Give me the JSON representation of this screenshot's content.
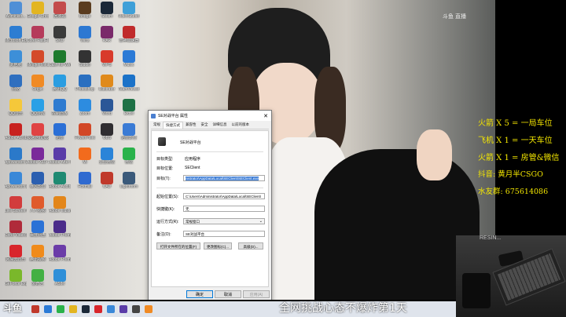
{
  "desktop": {
    "icons": [
      {
        "label": "Administr...",
        "color": "#4f8fd6"
      },
      {
        "label": "Google Chrome",
        "color": "#e3b521"
      },
      {
        "label": "回收站",
        "color": "#c34b4b"
      },
      {
        "label": "Microsoft Edge",
        "color": "#2d7dd2"
      },
      {
        "label": "Corel FastFlic...",
        "color": "#b53b5b"
      },
      {
        "label": "SKD",
        "color": "#3b3b3b"
      },
      {
        "label": "此电脑",
        "color": "#3d8fd8"
      },
      {
        "label": "Mindjet MindMan...",
        "color": "#d44a2a"
      },
      {
        "label": "Cash for Windows",
        "color": "#1e7a2d"
      },
      {
        "label": "网络",
        "color": "#2f6fbf"
      },
      {
        "label": "Origin",
        "color": "#f08a24"
      },
      {
        "label": "腾讯QQ",
        "color": "#2a9de1"
      },
      {
        "label": "QQ音乐",
        "color": "#f5c83a"
      },
      {
        "label": "QQ游戏",
        "color": "#2aa0e6"
      },
      {
        "label": "控制面板",
        "color": "#2f7bd0"
      },
      {
        "label": "Adobe Acrobat DC",
        "color": "#c8221f"
      },
      {
        "label": "极速游戏加速器",
        "color": "#e04343"
      },
      {
        "label": "迅雷",
        "color": "#2b6fd6"
      },
      {
        "label": "Apowersoft 录屏王",
        "color": "#2b79c9"
      },
      {
        "label": "Adobe X10 Transl...",
        "color": "#7a2a9a"
      },
      {
        "label": "Adobe After Effects CC",
        "color": "#5a3ca8"
      },
      {
        "label": "Apowersoft 录屏王",
        "color": "#3a88d8"
      },
      {
        "label": "暴风影音",
        "color": "#2b5fb0"
      },
      {
        "label": "Adobe Audition CC",
        "color": "#1f8a72"
      },
      {
        "label": "Live Screen Capture",
        "color": "#d23c3c"
      },
      {
        "label": "人人视频",
        "color": "#e05b2c"
      },
      {
        "label": "Adobe Illustrat...",
        "color": "#e3861a"
      },
      {
        "label": "Corel VideoStud...",
        "color": "#b02b3a"
      },
      {
        "label": "百度网盘",
        "color": "#2b72d6"
      },
      {
        "label": "Adobe Premiere...",
        "color": "#4b2c8a"
      },
      {
        "label": "网易云音乐",
        "color": "#d8252b"
      },
      {
        "label": "腾讯视频",
        "color": "#f08b1b"
      },
      {
        "label": "Adobe Premiere...",
        "color": "#6b3ca8"
      },
      {
        "label": "GeForce Experience",
        "color": "#7ab82b"
      },
      {
        "label": "爱奇艺",
        "color": "#43b043"
      },
      {
        "label": "ASIM",
        "color": "#2f8fd8"
      }
    ],
    "icons2": [
      {
        "label": "Bridge",
        "color": "#5a3c1f"
      },
      {
        "label": "Steam",
        "color": "#1b2838"
      },
      {
        "label": "VideoStudio Pro",
        "color": "#3fa0d8"
      },
      {
        "label": "Wins",
        "color": "#2d78d2"
      },
      {
        "label": "RAR",
        "color": "#7a2a6a"
      },
      {
        "label": "雷神加速器",
        "color": "#c02b2b"
      },
      {
        "label": "Studio",
        "color": "#333"
      },
      {
        "label": "WPS",
        "color": "#d83a2b"
      },
      {
        "label": "Music",
        "color": "#2b7ad6"
      },
      {
        "label": "Photoshop",
        "color": "#2a6fc0"
      },
      {
        "label": "Illustrator",
        "color": "#e08a1b"
      },
      {
        "label": "TeamViewer",
        "color": "#1b72c8"
      },
      {
        "label": "Zoom",
        "color": "#2d8ce0"
      },
      {
        "label": "Word",
        "color": "#2b5797"
      },
      {
        "label": "Excel",
        "color": "#1e7145"
      },
      {
        "label": "PowerPoint",
        "color": "#d24726"
      },
      {
        "label": "OBS",
        "color": "#302e31"
      },
      {
        "label": "迅雷影音",
        "color": "#3a7bd5"
      },
      {
        "label": "Mi",
        "color": "#f26b1d"
      },
      {
        "label": "企业微信",
        "color": "#2b84d8"
      },
      {
        "label": "微信",
        "color": "#2ab24a"
      },
      {
        "label": "Foxmail",
        "color": "#2f6ad0"
      },
      {
        "label": "CAD",
        "color": "#c0392b"
      },
      {
        "label": "Lightroom",
        "color": "#3b5a7a"
      }
    ],
    "watermark": "斗鱼 直播"
  },
  "dialog": {
    "title": "SE对战平台 属性",
    "close": "✕",
    "tabs": [
      "常规",
      "快捷方式",
      "兼容性",
      "安全",
      "详细信息",
      "以前的版本"
    ],
    "active_tab": 1,
    "header_name": "SE对战平台",
    "fields": {
      "target_type_label": "目标类型:",
      "target_type": "应用程序",
      "target_loc_label": "目标位置:",
      "target_loc": "SEClient",
      "target_label": "目标(T):",
      "target": "nistrator\\AppData\\Local\\SEClient\\SEClient.exe",
      "start_label": "起始位置(S):",
      "start": "C:\\Users\\Administrator\\AppData\\Local\\SEClient\\",
      "hotkey_label": "快捷键(K):",
      "hotkey": "无",
      "run_label": "运行方式(R):",
      "run": "常规窗口",
      "comment_label": "备注(O):",
      "comment": "SE对战平台"
    },
    "buttons": {
      "open_location": "打开文件所在的位置(F)",
      "change_icon": "更改图标(C)...",
      "advanced": "高级(D)..."
    },
    "footer": {
      "ok": "确定",
      "cancel": "取消",
      "apply": "应用(A)"
    }
  },
  "overlay": {
    "promo_lines": [
      "火箭 X 5 = 一局车位",
      "飞机 X 1 = 一天车位",
      "火箭 X 1 = 房管&微信",
      "抖音: 黄月半CSGO",
      "水友群: 675614086"
    ],
    "caption": "全网挑战心态不爆炸第1天",
    "brand": "斗鱼",
    "webcam_sign": "RESIN..."
  }
}
